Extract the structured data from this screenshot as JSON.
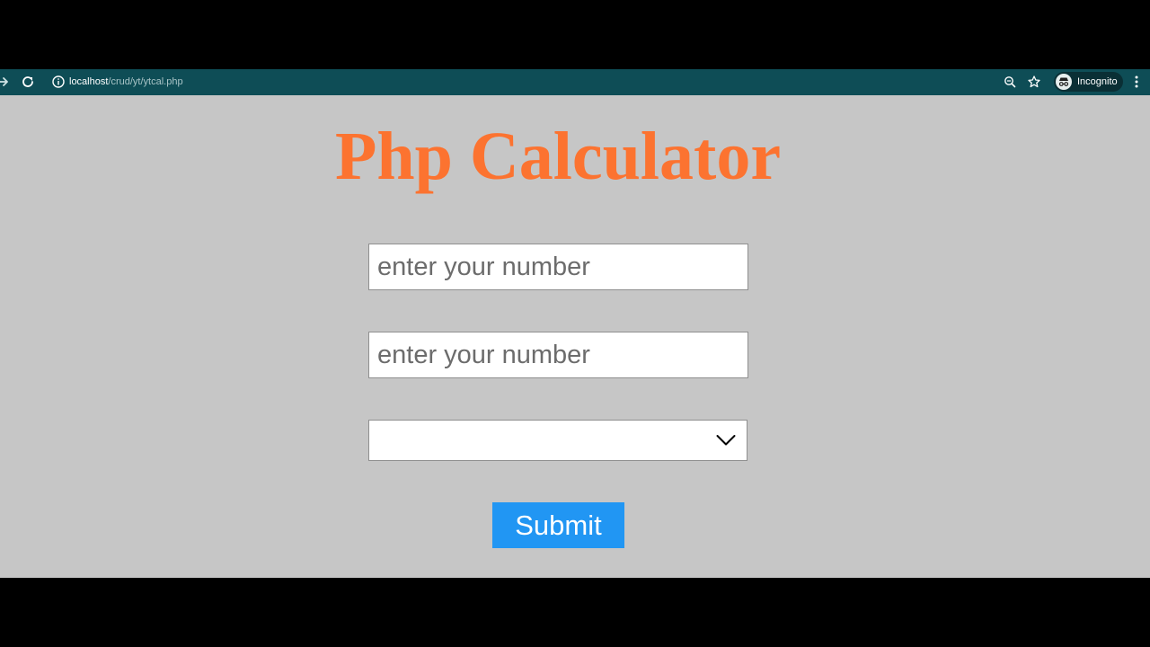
{
  "browser": {
    "url_host": "localhost",
    "url_path": "/crud/yt/ytcal.php",
    "incognito_label": "Incognito",
    "toolbar_color": "#0e4d56"
  },
  "page": {
    "title": "Php Calculator",
    "title_color": "#fc7330",
    "background_color": "#c6c6c6",
    "first_number": {
      "value": "",
      "placeholder": "enter your number"
    },
    "second_number": {
      "value": "",
      "placeholder": "enter your number"
    },
    "operation": {
      "selected": ""
    },
    "submit_label": "Submit",
    "submit_color": "#2196f3"
  },
  "icons": {
    "forward": "forward-arrow-icon",
    "reload": "reload-icon",
    "site_info": "info-icon",
    "zoom": "zoom-icon",
    "bookmark": "star-icon",
    "incognito": "incognito-icon",
    "menu": "kebab-menu-icon",
    "dropdown": "chevron-down-icon"
  }
}
